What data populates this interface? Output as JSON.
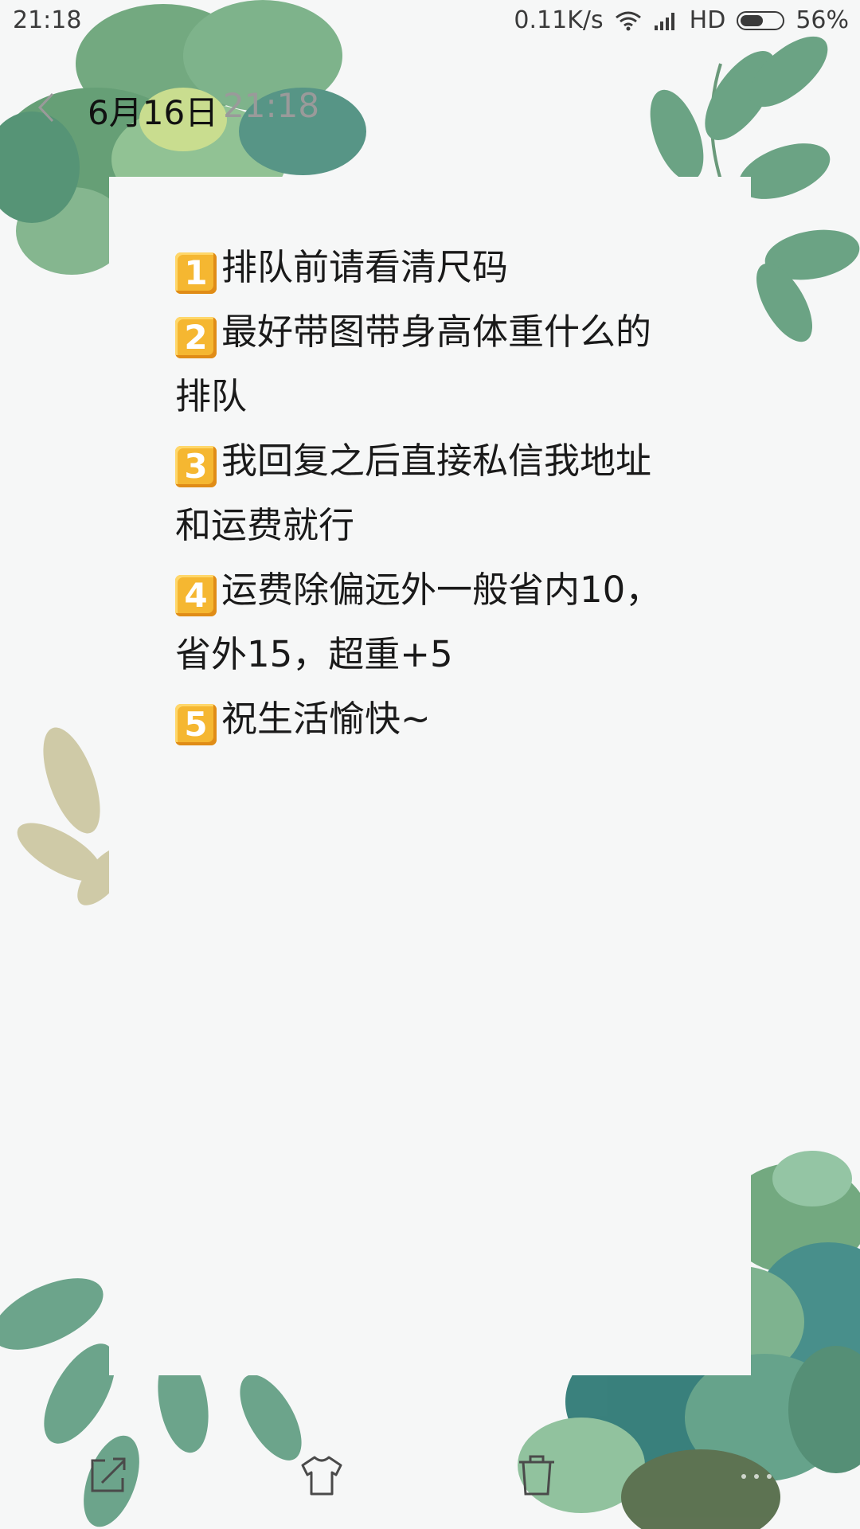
{
  "status_bar": {
    "time": "21:18",
    "net_speed": "0.11K/s",
    "hd_label": "HD",
    "battery_percent": "56%",
    "battery_level": 0.56,
    "icons": [
      "wifi-icon",
      "signal-icon",
      "battery-icon"
    ]
  },
  "header": {
    "date": "6月16日",
    "time": "21:18",
    "back_icon": "chevron-left-icon"
  },
  "note": {
    "lines": [
      {
        "badge": "1",
        "text": "排队前请看清尺码"
      },
      {
        "badge": "2",
        "text": "最好带图带身高体重什么的"
      },
      {
        "badge": "",
        "text": "排队"
      },
      {
        "badge": "3",
        "text": "我回复之后直接私信我地址"
      },
      {
        "badge": "",
        "text": "和运费就行"
      },
      {
        "badge": "4",
        "text": "运费除偏远外一般省内10，"
      },
      {
        "badge": "",
        "text": "省外15，超重+5"
      },
      {
        "badge": "5",
        "text": "祝生活愉快~"
      }
    ]
  },
  "toolbar": {
    "icons": [
      "share-icon",
      "theme-shirt-icon",
      "trash-icon",
      "more-icon"
    ]
  },
  "colors": {
    "background": "#f6f7f7",
    "badge": "#f5b731",
    "leaf_green": "#5e9c6e",
    "leaf_teal": "#3f8a86",
    "leaf_beige": "#c9c39a"
  }
}
